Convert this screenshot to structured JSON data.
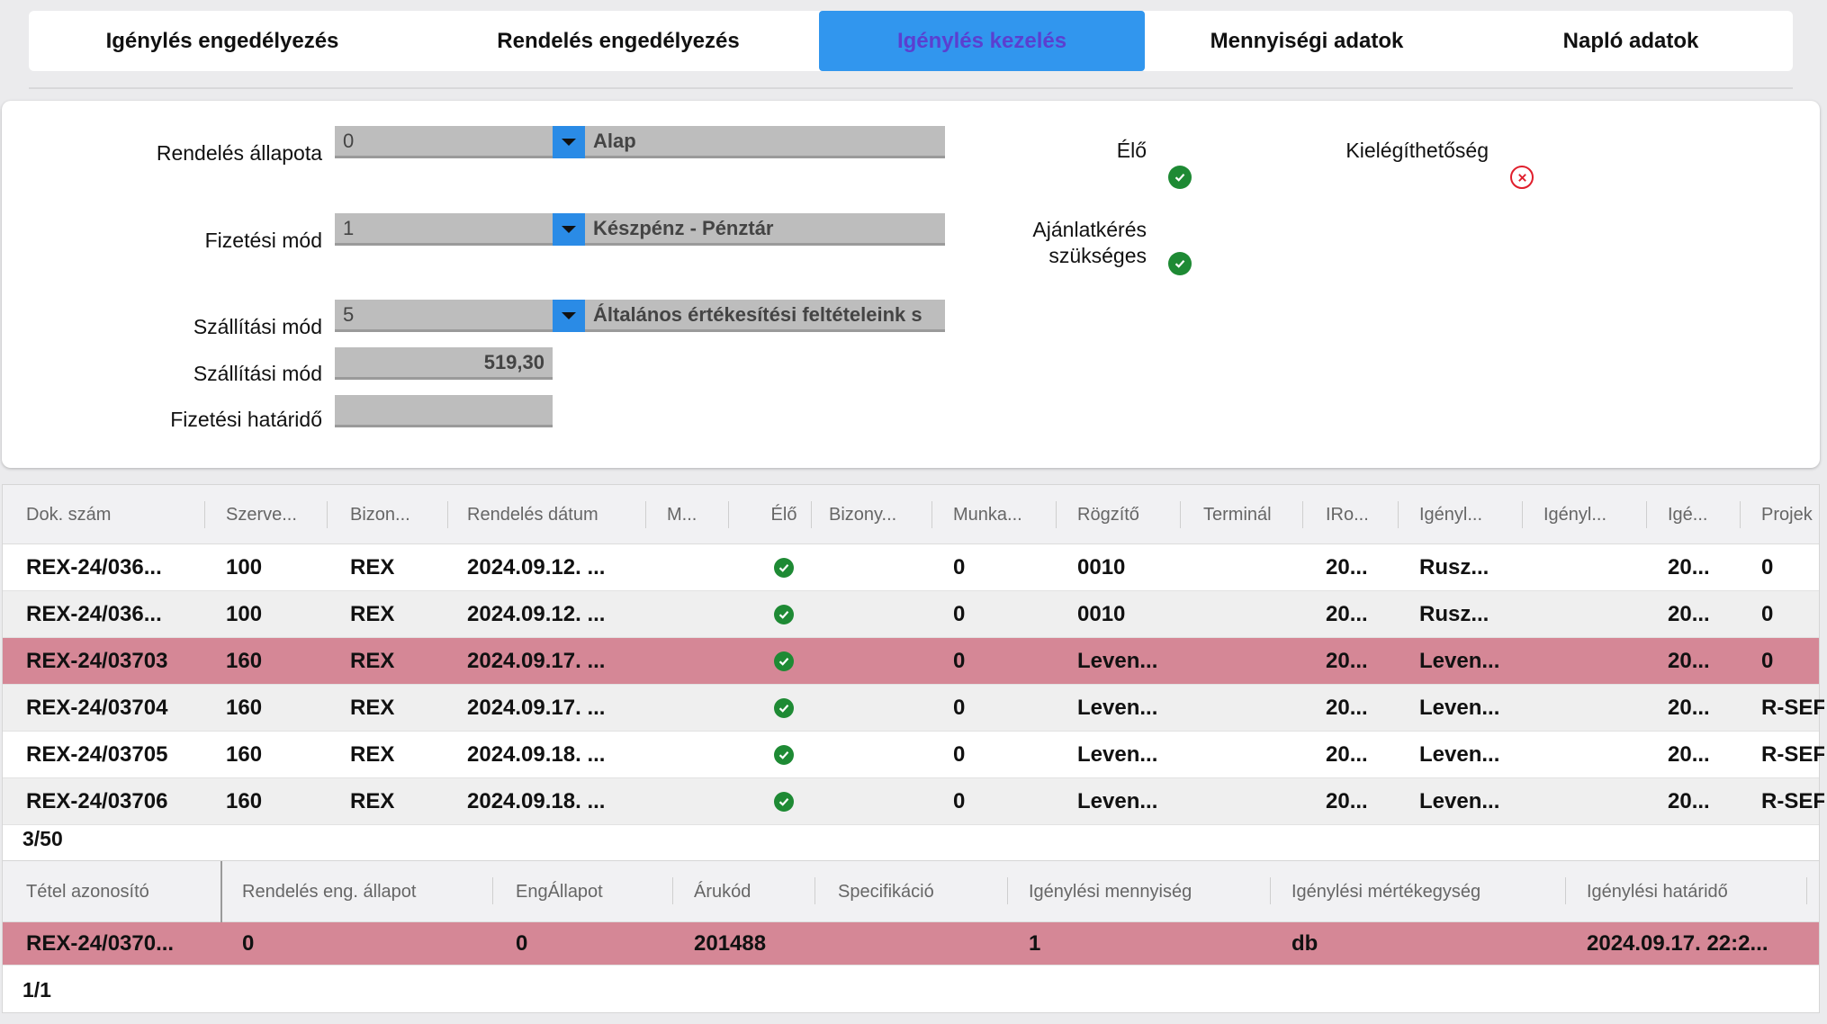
{
  "tabs": [
    {
      "label": "Igénylés engedélyezés",
      "active": false
    },
    {
      "label": "Rendelés engedélyezés",
      "active": false
    },
    {
      "label": "Igénylés kezelés",
      "active": true
    },
    {
      "label": "Mennyiségi adatok",
      "active": false
    },
    {
      "label": "Napló adatok",
      "active": false
    }
  ],
  "form": {
    "order_status": {
      "label": "Rendelés állapota",
      "code": "0",
      "text": "Alap"
    },
    "payment_mode": {
      "label": "Fizetési mód",
      "code": "1",
      "text": "Készpénz - Pénztár"
    },
    "shipping_mode": {
      "label": "Szállítási mód",
      "code": "5",
      "text": "Általános értékesítési feltételeink s"
    },
    "shipping_amount": {
      "label": "Szállítási mód",
      "value": "519,30"
    },
    "payment_deadline": {
      "label": "Fizetési határidő",
      "value": ""
    },
    "live": {
      "label": "Élő",
      "state": "check"
    },
    "quote_required": {
      "label_line1": "Ajánlatkérés",
      "label_line2": "szükséges",
      "state": "check"
    },
    "satisfiability": {
      "label": "Kielégíthetőség",
      "state": "x"
    }
  },
  "orders_table": {
    "columns": [
      "Dok. szám",
      "Szerve...",
      "Bizon...",
      "Rendelés dátum",
      "M...",
      "Élő",
      "Bizony...",
      "Munka...",
      "Rögzítő",
      "Terminál",
      "IRo...",
      "Igényl...",
      "Igényl...",
      "Igé...",
      "Projek"
    ],
    "rows": [
      {
        "doc": "REX-24/036...",
        "org": "100",
        "biz": "REX",
        "date": "2024.09.12. ...",
        "m": "",
        "elo": "check",
        "bizony": "",
        "munka": "0",
        "rogzito": "0010",
        "terminal": "",
        "iro": "20...",
        "igenyl1": "Rusz...",
        "igenyl2": "",
        "ige": "20...",
        "projekt": "0",
        "style": "normal"
      },
      {
        "doc": "REX-24/036...",
        "org": "100",
        "biz": "REX",
        "date": "2024.09.12. ...",
        "m": "",
        "elo": "check",
        "bizony": "",
        "munka": "0",
        "rogzito": "0010",
        "terminal": "",
        "iro": "20...",
        "igenyl1": "Rusz...",
        "igenyl2": "",
        "ige": "20...",
        "projekt": "0",
        "style": "alt"
      },
      {
        "doc": "REX-24/03703",
        "org": "160",
        "biz": "REX",
        "date": "2024.09.17. ...",
        "m": "",
        "elo": "check",
        "bizony": "",
        "munka": "0",
        "rogzito": "Leven...",
        "terminal": "",
        "iro": "20...",
        "igenyl1": "Leven...",
        "igenyl2": "",
        "ige": "20...",
        "projekt": "0",
        "style": "sel"
      },
      {
        "doc": "REX-24/03704",
        "org": "160",
        "biz": "REX",
        "date": "2024.09.17. ...",
        "m": "",
        "elo": "check",
        "bizony": "",
        "munka": "0",
        "rogzito": "Leven...",
        "terminal": "",
        "iro": "20...",
        "igenyl1": "Leven...",
        "igenyl2": "",
        "ige": "20...",
        "projekt": "R-SEF",
        "style": "alt"
      },
      {
        "doc": "REX-24/03705",
        "org": "160",
        "biz": "REX",
        "date": "2024.09.18. ...",
        "m": "",
        "elo": "check",
        "bizony": "",
        "munka": "0",
        "rogzito": "Leven...",
        "terminal": "",
        "iro": "20...",
        "igenyl1": "Leven...",
        "igenyl2": "",
        "ige": "20...",
        "projekt": "R-SEF",
        "style": "normal"
      },
      {
        "doc": "REX-24/03706",
        "org": "160",
        "biz": "REX",
        "date": "2024.09.18. ...",
        "m": "",
        "elo": "check",
        "bizony": "",
        "munka": "0",
        "rogzito": "Leven...",
        "terminal": "",
        "iro": "20...",
        "igenyl1": "Leven...",
        "igenyl2": "",
        "ige": "20...",
        "projekt": "R-SEF",
        "style": "alt"
      }
    ],
    "count": "3/50"
  },
  "items_table": {
    "columns": [
      "Tétel azonosító",
      "Rendelés eng. állapot",
      "EngÁllapot",
      "Árukód",
      "Specifikáció",
      "Igénylési mennyiség",
      "Igénylési mértékegység",
      "Igénylési határidő"
    ],
    "rows": [
      {
        "id": "REX-24/0370...",
        "rend_eng": "0",
        "eng": "0",
        "arukod": "201488",
        "spec": "",
        "menny": "1",
        "mertekegyseg": "db",
        "hatarido": "2024.09.17. 22:2...",
        "style": "sel"
      }
    ],
    "count": "1/1"
  },
  "colors": {
    "accent": "#3196ee",
    "selected_row": "#d58796",
    "check": "#1e8a34",
    "error": "#e01e2c"
  }
}
